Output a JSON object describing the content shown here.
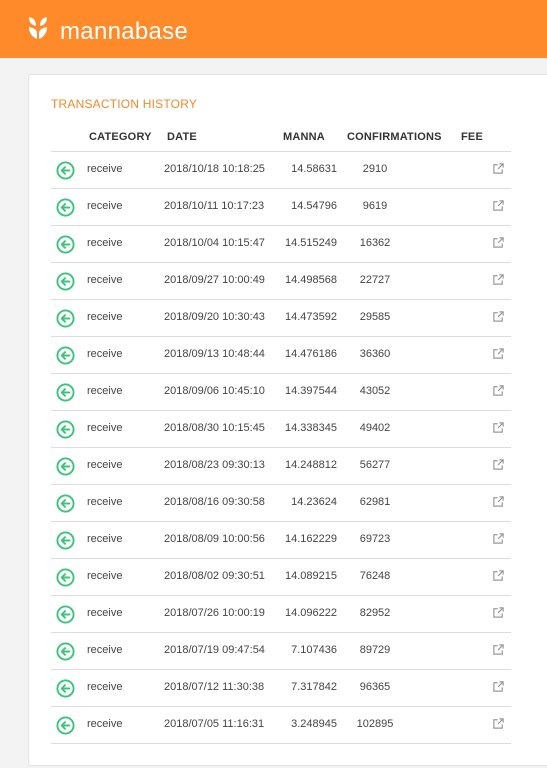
{
  "app": {
    "brand": "mannabase"
  },
  "colors": {
    "header": "#ff8a2a",
    "title": "#f08a2a",
    "receive_icon": "#3cc47c",
    "link_icon": "#9a9a9a"
  },
  "transactions": {
    "title": "TRANSACTION HISTORY",
    "columns": {
      "category": "CATEGORY",
      "date": "DATE",
      "manna": "MANNA",
      "confirmations": "CONFIRMATIONS",
      "fee": "FEE"
    },
    "rows": [
      {
        "category": "receive",
        "date": "2018/10/18 10:18:25",
        "manna": "14.58631",
        "confirmations": "2910"
      },
      {
        "category": "receive",
        "date": "2018/10/11 10:17:23",
        "manna": "14.54796",
        "confirmations": "9619"
      },
      {
        "category": "receive",
        "date": "2018/10/04 10:15:47",
        "manna": "14.515249",
        "confirmations": "16362"
      },
      {
        "category": "receive",
        "date": "2018/09/27 10:00:49",
        "manna": "14.498568",
        "confirmations": "22727"
      },
      {
        "category": "receive",
        "date": "2018/09/20 10:30:43",
        "manna": "14.473592",
        "confirmations": "29585"
      },
      {
        "category": "receive",
        "date": "2018/09/13 10:48:44",
        "manna": "14.476186",
        "confirmations": "36360"
      },
      {
        "category": "receive",
        "date": "2018/09/06 10:45:10",
        "manna": "14.397544",
        "confirmations": "43052"
      },
      {
        "category": "receive",
        "date": "2018/08/30 10:15:45",
        "manna": "14.338345",
        "confirmations": "49402"
      },
      {
        "category": "receive",
        "date": "2018/08/23 09:30:13",
        "manna": "14.248812",
        "confirmations": "56277"
      },
      {
        "category": "receive",
        "date": "2018/08/16 09:30:58",
        "manna": "14.23624",
        "confirmations": "62981"
      },
      {
        "category": "receive",
        "date": "2018/08/09 10:00:56",
        "manna": "14.162229",
        "confirmations": "69723"
      },
      {
        "category": "receive",
        "date": "2018/08/02 09:30:51",
        "manna": "14.089215",
        "confirmations": "76248"
      },
      {
        "category": "receive",
        "date": "2018/07/26 10:00:19",
        "manna": "14.096222",
        "confirmations": "82952"
      },
      {
        "category": "receive",
        "date": "2018/07/19 09:47:54",
        "manna": "7.107436",
        "confirmations": "89729"
      },
      {
        "category": "receive",
        "date": "2018/07/12 11:30:38",
        "manna": "7.317842",
        "confirmations": "96365"
      },
      {
        "category": "receive",
        "date": "2018/07/05 11:16:31",
        "manna": "3.248945",
        "confirmations": "102895"
      }
    ]
  }
}
